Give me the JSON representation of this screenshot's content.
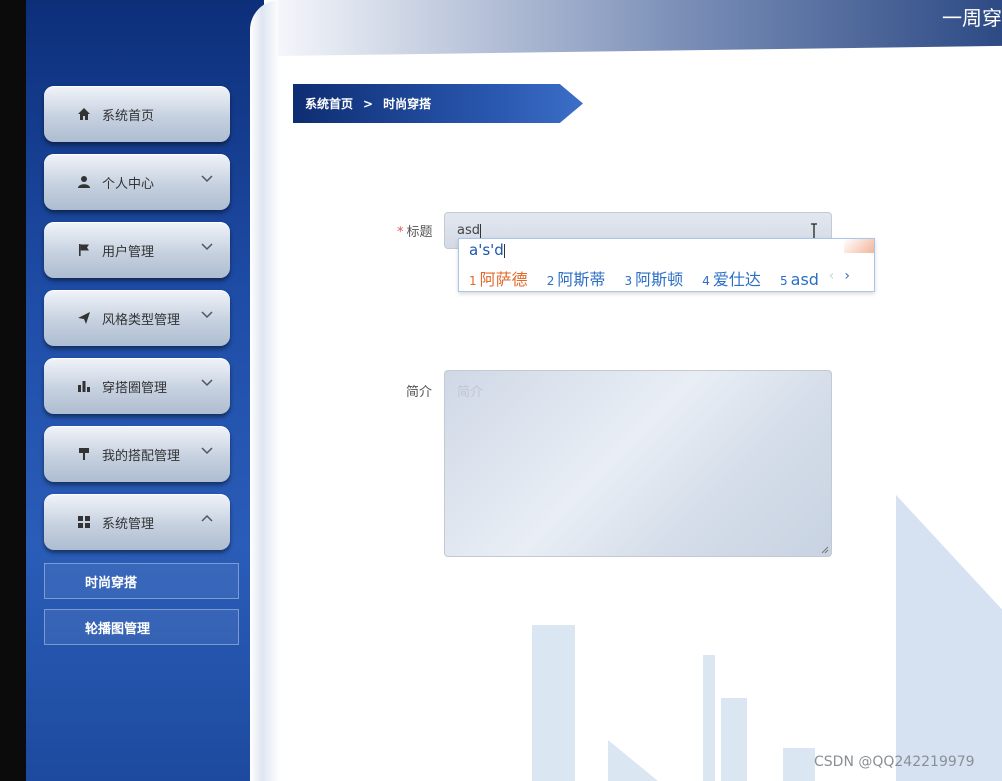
{
  "header": {
    "title": "一周穿"
  },
  "sidebar": {
    "items": [
      {
        "label": "系统首页",
        "icon": "home-icon",
        "has_chevron": false
      },
      {
        "label": "个人中心",
        "icon": "user-icon",
        "has_chevron": true
      },
      {
        "label": "用户管理",
        "icon": "flag-icon",
        "has_chevron": true
      },
      {
        "label": "风格类型管理",
        "icon": "paper-plane-icon",
        "has_chevron": true
      },
      {
        "label": "穿搭圈管理",
        "icon": "bar-chart-icon",
        "has_chevron": true
      },
      {
        "label": "我的搭配管理",
        "icon": "paint-roller-icon",
        "has_chevron": true
      },
      {
        "label": "系统管理",
        "icon": "grid-icon",
        "has_chevron": true,
        "expanded": true
      }
    ],
    "subitems": [
      {
        "label": "时尚穿搭"
      },
      {
        "label": "轮播图管理"
      }
    ]
  },
  "breadcrumb": {
    "home": "系统首页",
    "separator": ">",
    "current": "时尚穿搭"
  },
  "form": {
    "title_label": "标题",
    "required_mark": "*",
    "title_value": "asd",
    "intro_label": "简介",
    "intro_placeholder": "简介"
  },
  "ime": {
    "composition": "a's'd",
    "candidates": [
      {
        "num": "1",
        "text": "阿萨德"
      },
      {
        "num": "2",
        "text": "阿斯蒂"
      },
      {
        "num": "3",
        "text": "阿斯顿"
      },
      {
        "num": "4",
        "text": "爱仕达"
      },
      {
        "num": "5",
        "text": "asd"
      }
    ],
    "prev": "‹",
    "next": "›"
  },
  "watermark": "CSDN @QQ242219979",
  "colors": {
    "sidebar": "#1f4ea8",
    "accent": "#2b6fc4",
    "candidate_highlight": "#e06a2a",
    "required": "#e45656"
  }
}
